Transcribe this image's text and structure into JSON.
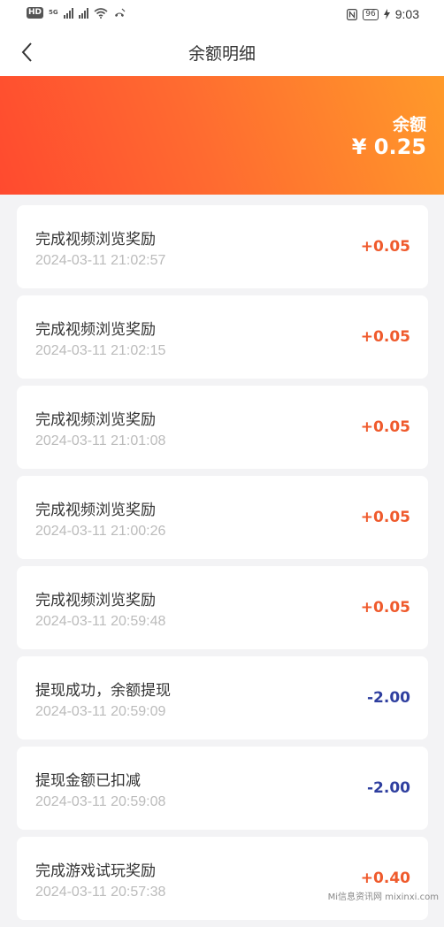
{
  "status_bar": {
    "left_badge": "HD",
    "network": "5G",
    "time": "9:03",
    "battery": "96"
  },
  "nav": {
    "title": "余额明细"
  },
  "balance": {
    "label": "余额",
    "amount": "¥ 0.25"
  },
  "records": [
    {
      "title": "完成视频浏览奖励",
      "time": "2024-03-11 21:02:57",
      "amount": "+0.05",
      "type": "income"
    },
    {
      "title": "完成视频浏览奖励",
      "time": "2024-03-11 21:02:15",
      "amount": "+0.05",
      "type": "income"
    },
    {
      "title": "完成视频浏览奖励",
      "time": "2024-03-11 21:01:08",
      "amount": "+0.05",
      "type": "income"
    },
    {
      "title": "完成视频浏览奖励",
      "time": "2024-03-11 21:00:26",
      "amount": "+0.05",
      "type": "income"
    },
    {
      "title": "完成视频浏览奖励",
      "time": "2024-03-11 20:59:48",
      "amount": "+0.05",
      "type": "income"
    },
    {
      "title": "提现成功，余额提现",
      "time": "2024-03-11 20:59:09",
      "amount": "-2.00",
      "type": "expense"
    },
    {
      "title": "提现金额已扣减",
      "time": "2024-03-11 20:59:08",
      "amount": "-2.00",
      "type": "expense"
    },
    {
      "title": "完成游戏试玩奖励",
      "time": "2024-03-11 20:57:38",
      "amount": "+0.40",
      "type": "income"
    }
  ],
  "colors": {
    "income": "#ef5a2c",
    "expense": "#2f3f9f",
    "banner_start": "#ff4a2f",
    "banner_end": "#ff9a2a"
  },
  "icons": {
    "back": "chevron-left-icon"
  },
  "watermark": "Mi信息资讯网 mixinxi.com"
}
